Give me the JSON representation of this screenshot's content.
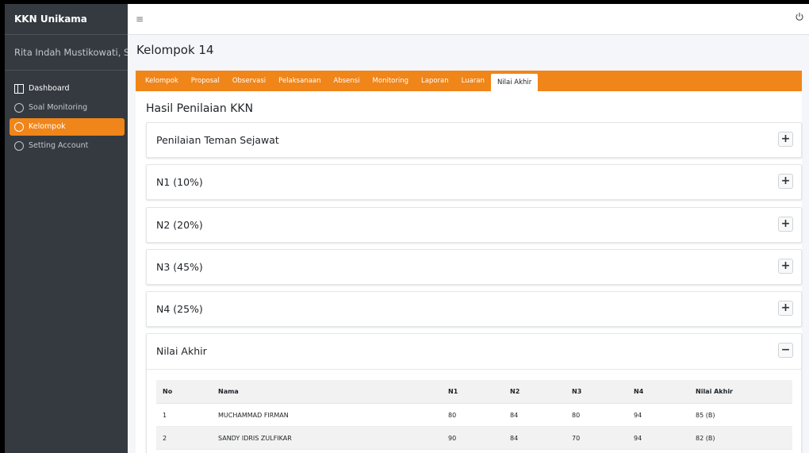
{
  "sidebar": {
    "brand": "KKN Unikama",
    "user": "Rita Indah Mustikowati, S",
    "items": [
      {
        "label": "Dashboard",
        "icon": "dashboard-icon"
      },
      {
        "label": "Soal Monitoring",
        "icon": "circle-icon"
      },
      {
        "label": "Kelompok",
        "icon": "circle-icon",
        "active": true
      },
      {
        "label": "Setting Account",
        "icon": "circle-icon"
      }
    ]
  },
  "topbar": {
    "menu_icon": "≡",
    "power_icon": "power-icon"
  },
  "page": {
    "title": "Kelompok 14",
    "tabs": [
      "Kelompok",
      "Proposal",
      "Observasi",
      "Pelaksanaan",
      "Absensi",
      "Monitoring",
      "Laporan",
      "Luaran",
      "Nilai Akhir"
    ],
    "active_tab": "Nilai Akhir",
    "section_title": "Hasil Penilaian KKN",
    "cards": [
      {
        "label": "Penilaian Teman Sejawat",
        "toggle": "+"
      },
      {
        "label": "N1 (10%)",
        "toggle": "+"
      },
      {
        "label": "N2 (20%)",
        "toggle": "+"
      },
      {
        "label": "N3 (45%)",
        "toggle": "+"
      },
      {
        "label": "N4 (25%)",
        "toggle": "+"
      },
      {
        "label": "Nilai Akhir",
        "toggle": "−"
      }
    ],
    "table": {
      "headers": [
        "No",
        "Nama",
        "N1",
        "N2",
        "N3",
        "N4",
        "Nilai Akhir"
      ],
      "rows": [
        [
          "1",
          "MUCHAMMAD FIRMAN",
          "80",
          "84",
          "80",
          "94",
          "85 (B)"
        ],
        [
          "2",
          "SANDY IDRIS ZULFIKAR",
          "90",
          "84",
          "70",
          "94",
          "82 (B)"
        ]
      ]
    }
  },
  "colors": {
    "accent": "#f08519",
    "sidebar": "#343a40"
  }
}
